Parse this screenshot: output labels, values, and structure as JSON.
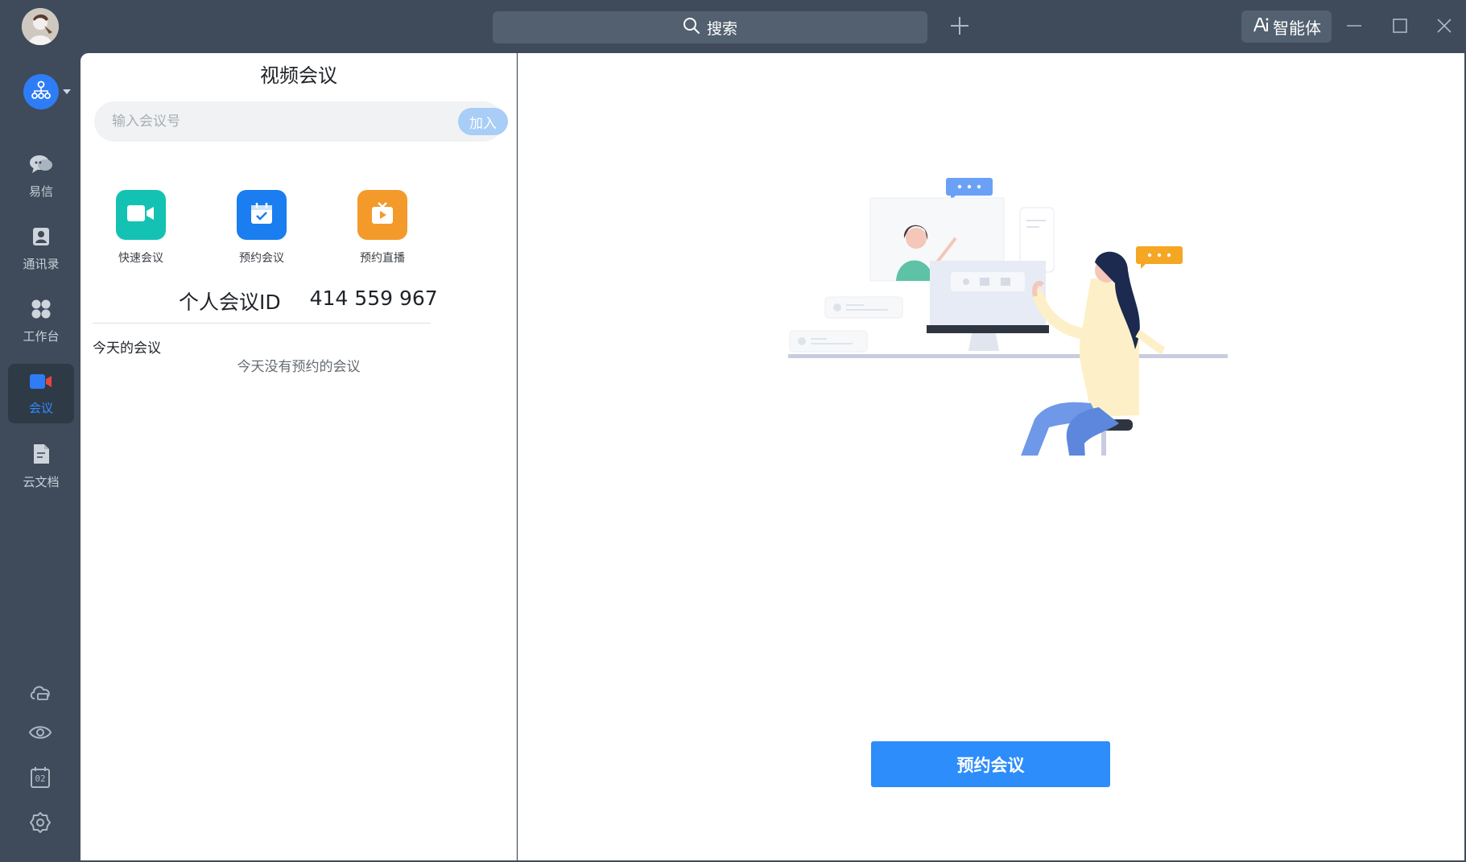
{
  "header": {
    "search_label": "搜索",
    "agent_label": "智能体"
  },
  "nav": {
    "items": [
      {
        "label": "易信"
      },
      {
        "label": "通讯录"
      },
      {
        "label": "工作台"
      },
      {
        "label": "会议"
      },
      {
        "label": "云文档"
      }
    ],
    "calendar_day": "02"
  },
  "panel": {
    "title": "视频会议",
    "join_placeholder": "输入会议号",
    "join_label": "加入",
    "actions": [
      {
        "label": "快速会议",
        "color": "#14c2b4"
      },
      {
        "label": "预约会议",
        "color": "#1a7df0"
      },
      {
        "label": "预约直播",
        "color": "#f39a2b"
      }
    ],
    "personal_id_label": "个人会议ID",
    "personal_id_value": "414 559 967",
    "today_title": "今天的会议",
    "today_empty": "今天没有预约的会议"
  },
  "main": {
    "book_button_label": "预约会议"
  },
  "colors": {
    "accent": "#2c8dfb",
    "rail_bg": "#3f4b5a"
  }
}
